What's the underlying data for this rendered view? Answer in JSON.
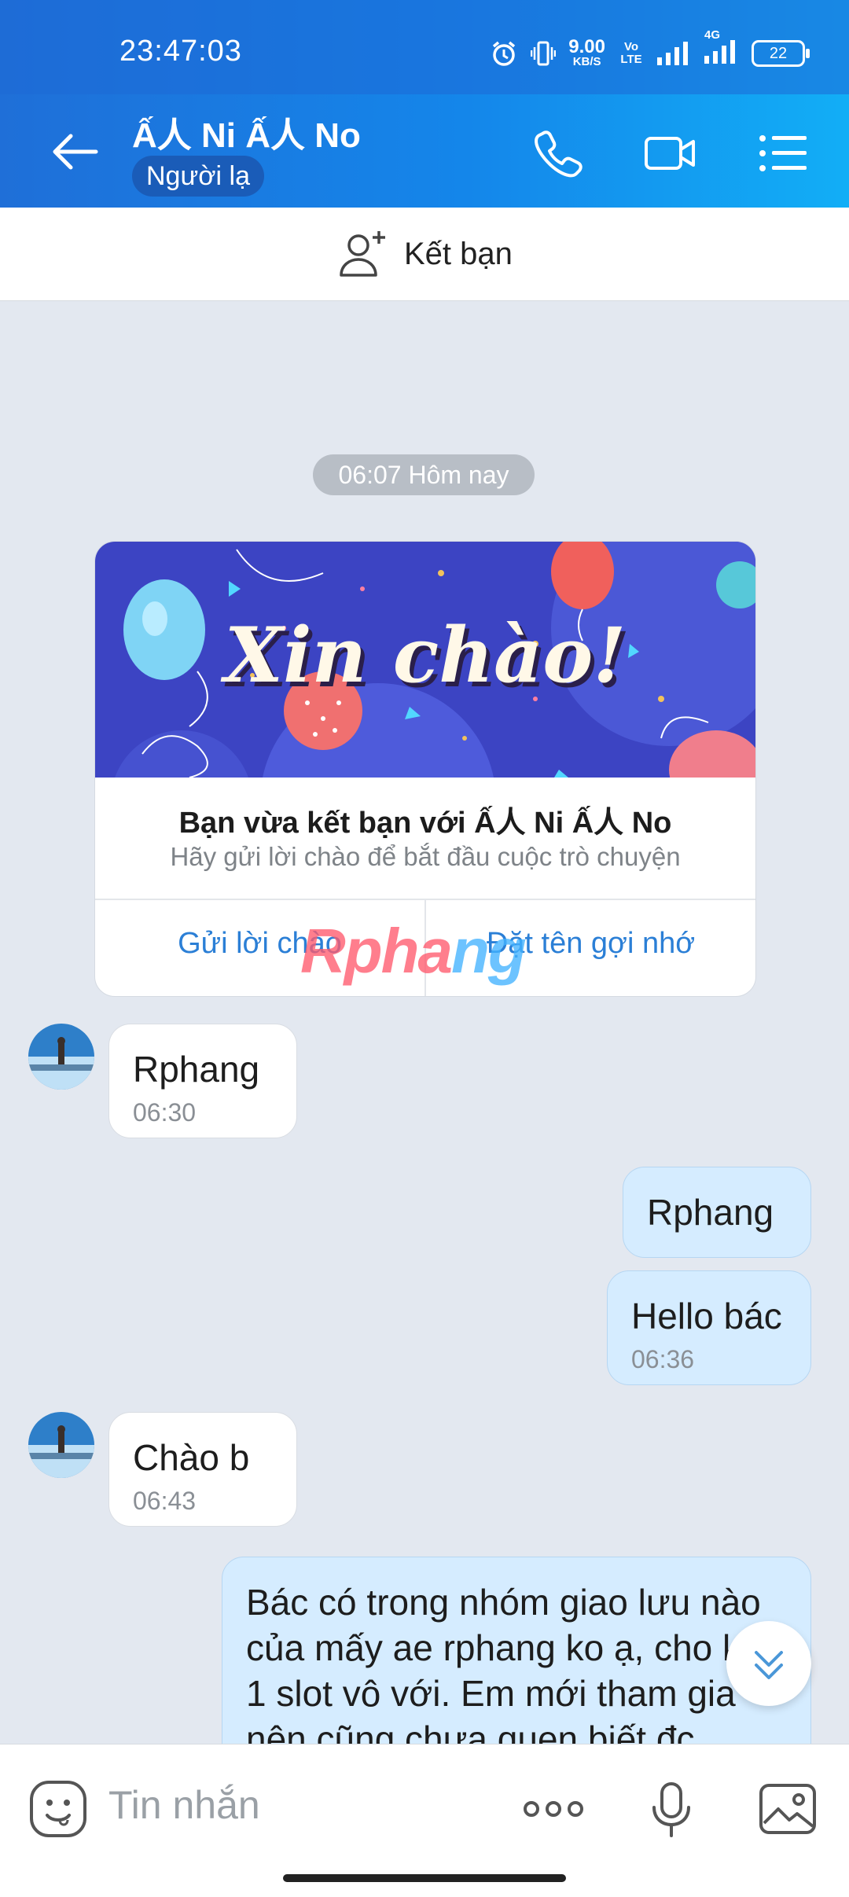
{
  "status_bar": {
    "time": "23:47:03",
    "net_speed": "9.00",
    "net_unit": "KB/S",
    "volte": "Vo LTE",
    "signal_label": "4G",
    "battery": "22"
  },
  "header": {
    "contact_name": "Ấ人 Ni Ấ人 No",
    "contact_tag": "Người lạ"
  },
  "friend_bar": {
    "label": "Kết bạn"
  },
  "date_chip": "06:07 Hôm nay",
  "greeting_card": {
    "banner_text": "Xin chào!",
    "title": "Bạn vừa kết bạn với Ấ人 Ni Ấ人 No",
    "subtitle": "Hãy gửi lời chào để bắt đầu cuộc trò chuyện",
    "send_greeting": "Gửi lời chào",
    "set_nickname": "Đặt tên gợi nhớ"
  },
  "watermark": "Rphang",
  "messages": [
    {
      "side": "received",
      "text": "Rphang",
      "time": "06:30"
    },
    {
      "side": "sent",
      "text": "Rphang",
      "time": ""
    },
    {
      "side": "sent",
      "text": "Hello bác",
      "time": "06:36"
    },
    {
      "side": "received",
      "text": "Chào b",
      "time": "06:43"
    },
    {
      "side": "sent",
      "text": "Bác có trong nhóm giao lưu nào của mấy ae rphang ko ạ, cho ké 1 slot vô với. Em mới tham gia nên cũng chưa quen biết đc",
      "time": ""
    }
  ],
  "input_bar": {
    "placeholder": "Tin nhắn"
  },
  "colors": {
    "header_start": "#1f6fd8",
    "header_end": "#12aef6",
    "chat_bg": "#e3e8f0",
    "sent_bubble": "#d5ecff",
    "link": "#2b7fd6"
  }
}
